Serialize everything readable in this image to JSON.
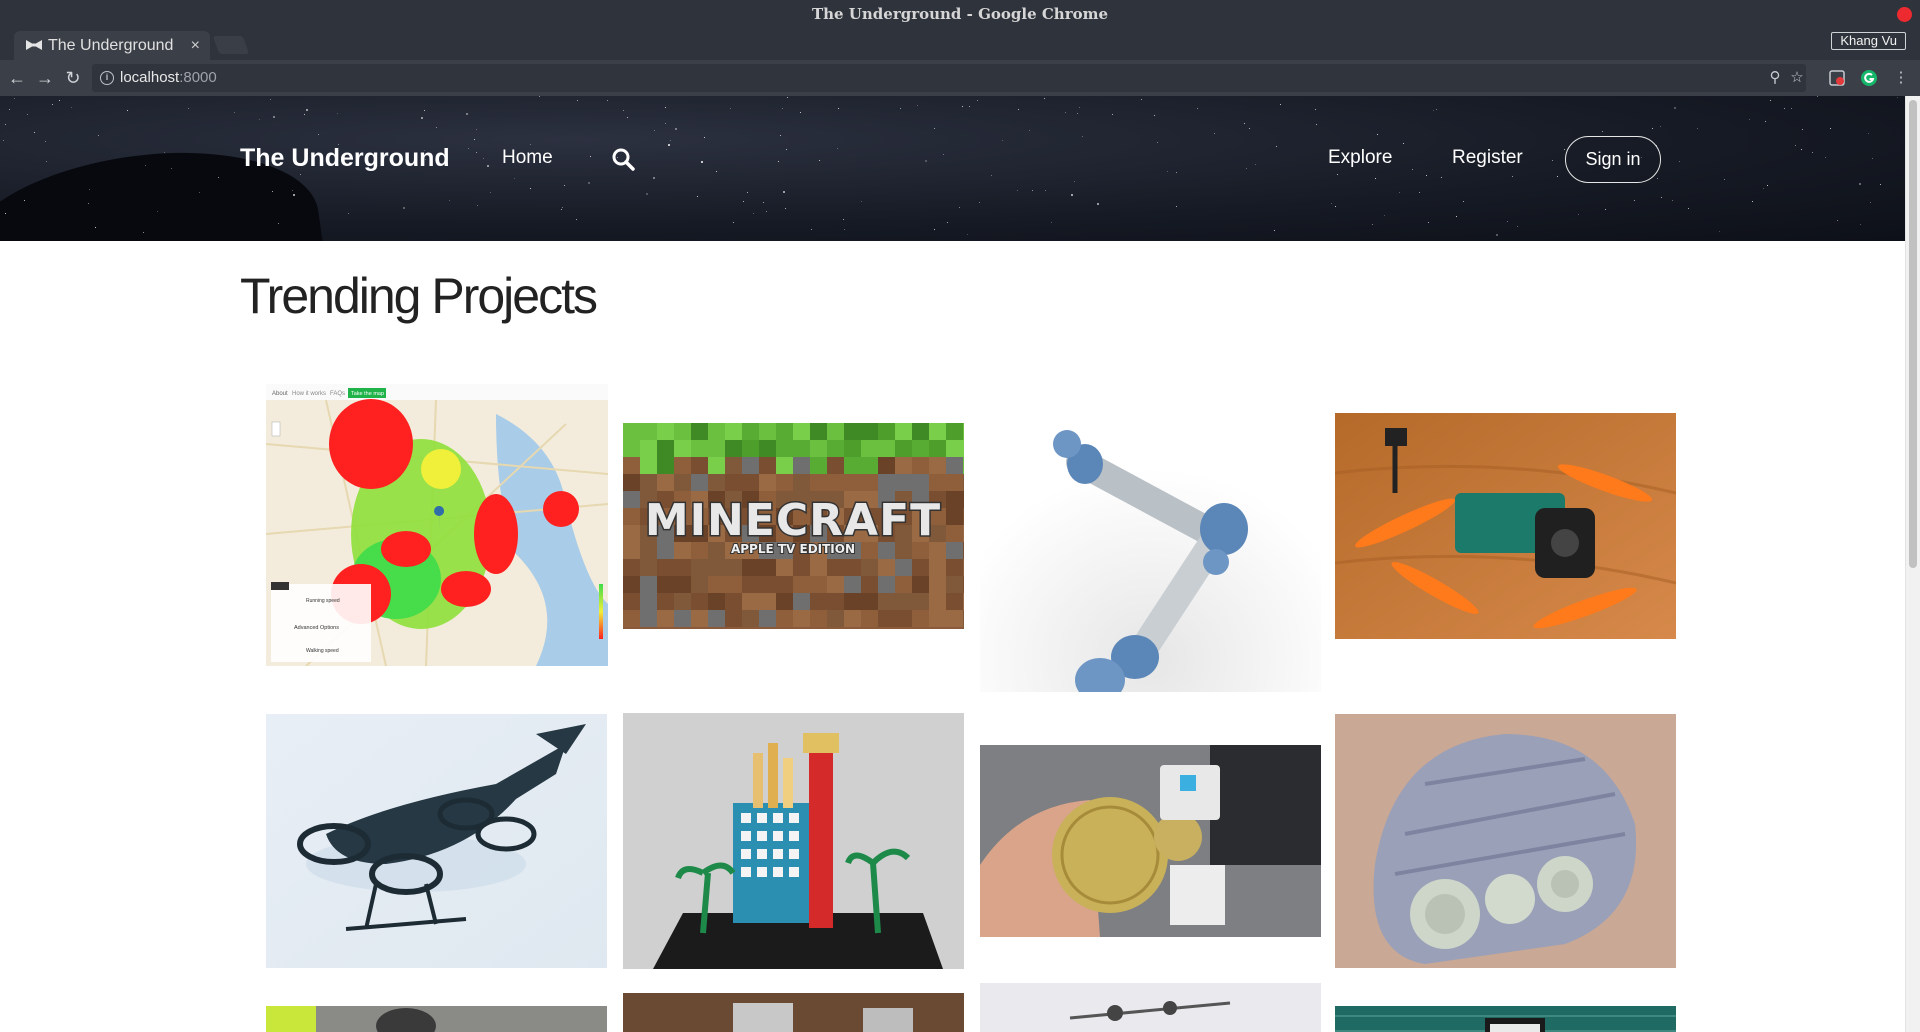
{
  "browser": {
    "window_title": "The Underground - Google Chrome",
    "tab_title": "The Underground",
    "profile_name": "Khang Vu",
    "url_host": "localhost",
    "url_port": ":8000"
  },
  "site": {
    "brand": "The Underground",
    "nav": {
      "home": "Home",
      "explore": "Explore",
      "register": "Register",
      "signin": "Sign in"
    }
  },
  "main": {
    "heading": "Trending Projects",
    "projects": [
      {
        "image": "heatmap"
      },
      {
        "image": "minecraft",
        "logo_text": "MINECRAFT",
        "logo_subtext": "APPLE TV EDITION"
      },
      {
        "image": "robot-arm"
      },
      {
        "image": "drone"
      },
      {
        "image": "aircraft"
      },
      {
        "image": "building-model"
      },
      {
        "image": "coin-robot"
      },
      {
        "image": "tank-tracks"
      },
      {
        "image": "project-9"
      },
      {
        "image": "project-10"
      },
      {
        "image": "project-11"
      },
      {
        "image": "project-12"
      }
    ]
  },
  "heatmap_card": {
    "tabs": [
      "About",
      "How it works",
      "FAQs",
      "Take the map"
    ],
    "panel_lines": [
      "Running speed",
      "Advanced Options",
      "Walking speed"
    ]
  }
}
